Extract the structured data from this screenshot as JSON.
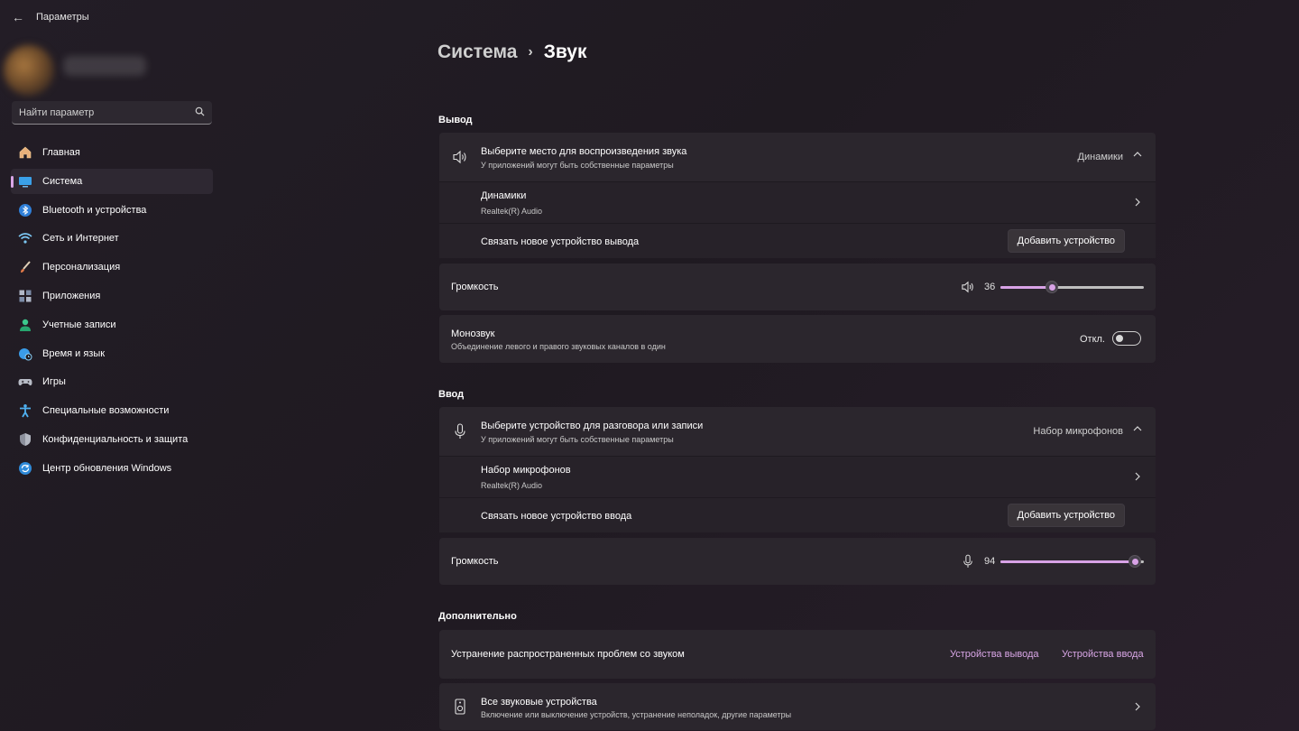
{
  "window": {
    "title": "Параметры"
  },
  "search": {
    "placeholder": "Найти параметр"
  },
  "sidebar": {
    "items": [
      {
        "label": "Главная",
        "icon": "home-icon"
      },
      {
        "label": "Система",
        "icon": "monitor-icon",
        "active": true
      },
      {
        "label": "Bluetooth и устройства",
        "icon": "bluetooth-icon"
      },
      {
        "label": "Сеть и Интернет",
        "icon": "wifi-icon"
      },
      {
        "label": "Персонализация",
        "icon": "brush-icon"
      },
      {
        "label": "Приложения",
        "icon": "apps-icon"
      },
      {
        "label": "Учетные записи",
        "icon": "person-icon"
      },
      {
        "label": "Время и язык",
        "icon": "globe-clock-icon"
      },
      {
        "label": "Игры",
        "icon": "gamepad-icon"
      },
      {
        "label": "Специальные возможности",
        "icon": "accessibility-icon"
      },
      {
        "label": "Конфиденциальность и защита",
        "icon": "shield-icon"
      },
      {
        "label": "Центр обновления Windows",
        "icon": "update-icon"
      }
    ]
  },
  "breadcrumb": {
    "parent": "Система",
    "current": "Звук"
  },
  "output": {
    "section_title": "Вывод",
    "device_select": {
      "title": "Выберите место для воспроизведения звука",
      "subtitle": "У приложений могут быть собственные параметры",
      "value": "Динамики"
    },
    "device": {
      "name": "Динамики",
      "driver": "Realtek(R) Audio"
    },
    "pair": {
      "label": "Связать новое устройство вывода",
      "button": "Добавить устройство"
    },
    "volume": {
      "label": "Громкость",
      "value": "36",
      "level": 36
    },
    "mono": {
      "title": "Монозвук",
      "subtitle": "Объединение левого и правого звуковых каналов в один",
      "state": "Откл."
    }
  },
  "input": {
    "section_title": "Ввод",
    "device_select": {
      "title": "Выберите устройство для разговора или записи",
      "subtitle": "У приложений могут быть собственные параметры",
      "value": "Набор микрофонов"
    },
    "device": {
      "name": "Набор микрофонов",
      "driver": "Realtek(R) Audio"
    },
    "pair": {
      "label": "Связать новое устройство ввода",
      "button": "Добавить устройство"
    },
    "volume": {
      "label": "Громкость",
      "value": "94",
      "level": 94
    }
  },
  "advanced": {
    "section_title": "Дополнительно",
    "troubleshoot": {
      "label": "Устранение распространенных проблем со звуком",
      "link_output": "Устройства вывода",
      "link_input": "Устройства ввода"
    },
    "all_devices": {
      "title": "Все звуковые устройства",
      "subtitle": "Включение или выключение устройств, устранение неполадок, другие параметры"
    }
  },
  "colors": {
    "accent": "#d8a2e6",
    "background": "#211c23",
    "card": "#2b262d"
  }
}
